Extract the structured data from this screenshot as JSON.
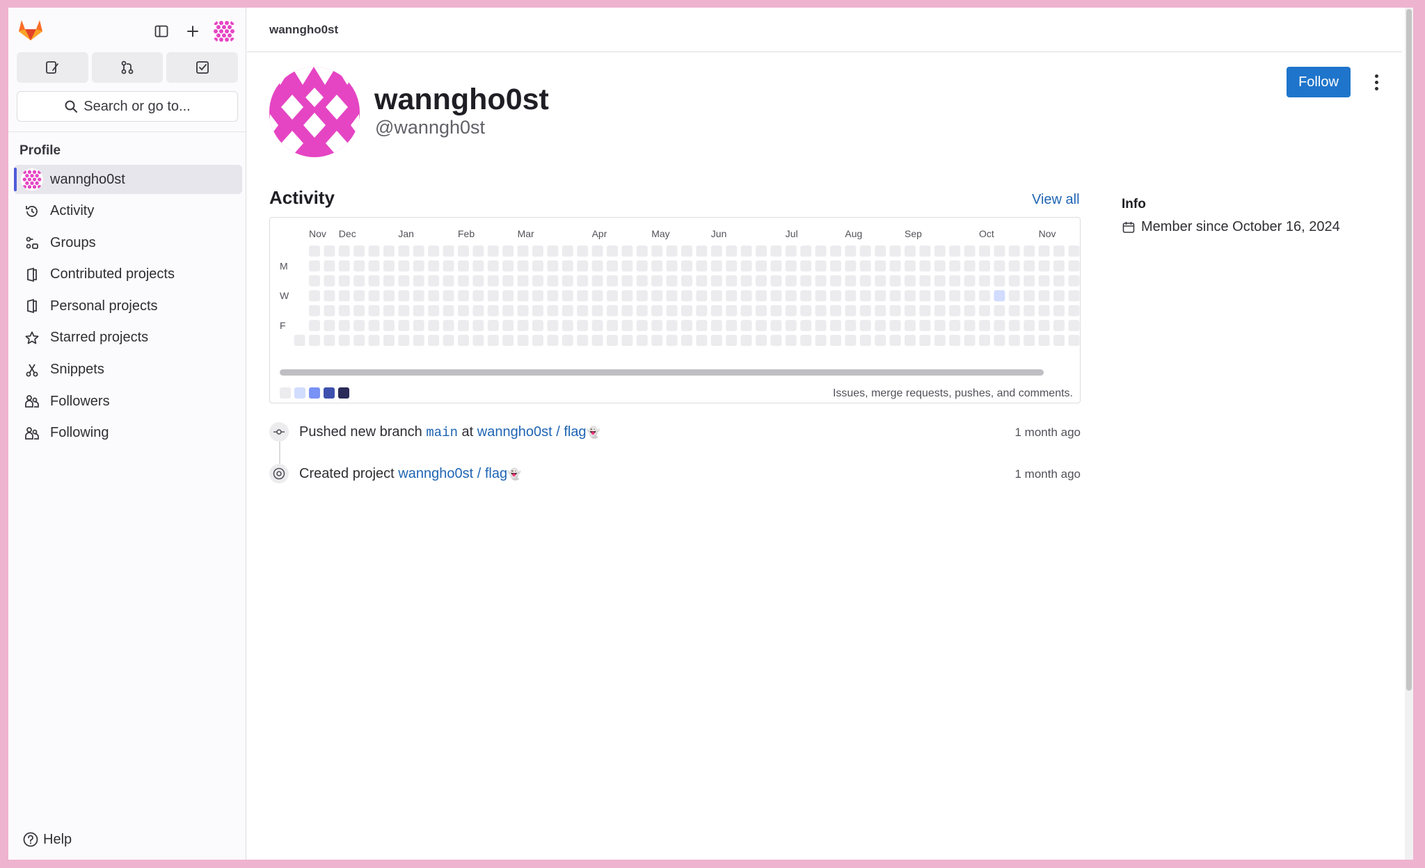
{
  "colors": {
    "accent": "#1f75cb",
    "avatar": "#e545c3",
    "cal_empty": "#ececef",
    "cal_levels": [
      "#ececef",
      "#d2dcff",
      "#7992f5",
      "#3f51ae",
      "#2a2b59"
    ]
  },
  "sidebar": {
    "logo": "gitlab-tanuki-logo",
    "search_label": "Search or go to...",
    "section_title": "Profile",
    "items": [
      {
        "label": "wanngho0st",
        "icon": "avatar",
        "active": true
      },
      {
        "label": "Activity",
        "icon": "history-icon"
      },
      {
        "label": "Groups",
        "icon": "groups-icon"
      },
      {
        "label": "Contributed projects",
        "icon": "project-icon"
      },
      {
        "label": "Personal projects",
        "icon": "project-icon"
      },
      {
        "label": "Starred projects",
        "icon": "star-icon"
      },
      {
        "label": "Snippets",
        "icon": "snippet-icon"
      },
      {
        "label": "Followers",
        "icon": "users-icon"
      },
      {
        "label": "Following",
        "icon": "users-icon"
      }
    ],
    "help_label": "Help"
  },
  "header": {
    "breadcrumb": "wanngho0st"
  },
  "profile": {
    "name": "wanngho0st",
    "handle": "@wanngh0st",
    "follow_label": "Follow"
  },
  "activity": {
    "title": "Activity",
    "view_all": "View all",
    "months": [
      "Nov",
      "Dec",
      "Jan",
      "Feb",
      "Mar",
      "Apr",
      "May",
      "Jun",
      "Jul",
      "Aug",
      "Sep",
      "Oct",
      "Nov"
    ],
    "day_labels": [
      "M",
      "W",
      "F"
    ],
    "caption": "Issues, merge requests, pushes, and comments.",
    "highlight": {
      "month": "Oct",
      "day": "W",
      "level": 1
    },
    "events": [
      {
        "action": "Pushed new branch",
        "branch": "main",
        "connector": "at",
        "project": "wanngho0st / flag",
        "time": "1 month ago",
        "icon": "commit-icon"
      },
      {
        "action": "Created project",
        "project": "wanngho0st / flag",
        "time": "1 month ago",
        "icon": "status-icon"
      }
    ]
  },
  "info": {
    "title": "Info",
    "member_since": "Member since October 16, 2024"
  }
}
